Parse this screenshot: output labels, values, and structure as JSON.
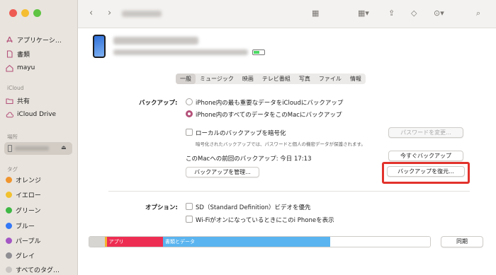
{
  "sidebar": {
    "items_top": [
      {
        "label": "アプリケーシ…",
        "icon": "app-store-icon"
      },
      {
        "label": "書類",
        "icon": "document-icon"
      },
      {
        "label": "mayu",
        "icon": "home-icon"
      }
    ],
    "icloud_header": "iCloud",
    "icloud_items": [
      {
        "label": "共有",
        "icon": "shared-folder-icon"
      },
      {
        "label": "iCloud Drive",
        "icon": "cloud-icon"
      }
    ],
    "locations_header": "場所",
    "tags_header": "タグ",
    "tags": [
      {
        "label": "オレンジ",
        "color": "#f0952e"
      },
      {
        "label": "イエロー",
        "color": "#f2c12e"
      },
      {
        "label": "グリーン",
        "color": "#3fb845"
      },
      {
        "label": "ブルー",
        "color": "#3478f6"
      },
      {
        "label": "パープル",
        "color": "#a457c4"
      },
      {
        "label": "グレイ",
        "color": "#8e8e93"
      },
      {
        "label": "すべてのタグ…",
        "color": "#c8c5c2"
      }
    ]
  },
  "tabs": [
    "一般",
    "ミュージック",
    "映画",
    "テレビ番組",
    "写真",
    "ファイル",
    "情報"
  ],
  "backup": {
    "section_label": "バックアップ:",
    "option_icloud": "iPhone内の最も重要なデータをiCloudにバックアップ",
    "option_mac": "iPhone内のすべてのデータをこのMacにバックアップ",
    "encrypt_label": "ローカルのバックアップを暗号化",
    "encrypt_note": "暗号化されたバックアップでは、パスワードと個人の機密データが保護されます。",
    "change_password": "パスワードを変更...",
    "last_backup": "このMacへの前回のバックアップ: 今日 17:13",
    "backup_now": "今すぐバックアップ",
    "manage": "バックアップを管理...",
    "restore": "バックアップを復元..."
  },
  "options": {
    "section_label": "オプション:",
    "sd_video": "SD（Standard Definition）ビデオを優先",
    "wifi_show": "Wi-Fiがオンになっているときにこのi Phoneを表示"
  },
  "storage": {
    "segments": [
      {
        "label": "",
        "color": "#d7d5d2",
        "fraction": 0.045
      },
      {
        "label": "",
        "color": "#f5b431",
        "fraction": 0.006
      },
      {
        "label": "アプリ",
        "color": "#ee2d52",
        "fraction": 0.165
      },
      {
        "label": "書類とデータ",
        "color": "#5ab4ef",
        "fraction": 0.49
      },
      {
        "label": "",
        "color": "#ffffff",
        "fraction": 0.294
      }
    ]
  },
  "sync_button": "同期",
  "accent": "#b4527a",
  "highlight_color": "#e2322c"
}
